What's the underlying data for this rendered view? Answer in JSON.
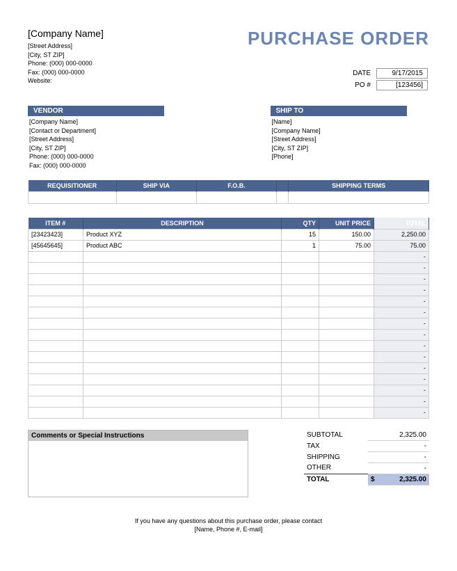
{
  "header": {
    "company_name": "[Company Name]",
    "street": "[Street Address]",
    "citystzip": "[City, ST  ZIP]",
    "phone_lbl": "Phone:",
    "phone": "(000) 000-0000",
    "fax_lbl": "Fax:",
    "fax": "(000) 000-0000",
    "website_lbl": "Website:"
  },
  "title": "PURCHASE ORDER",
  "meta": {
    "date_lbl": "DATE",
    "date": "9/17/2015",
    "po_lbl": "PO #",
    "po": "[123456]"
  },
  "vendor": {
    "hdr": "VENDOR",
    "lines": [
      "[Company Name]",
      "[Contact or Department]",
      "[Street Address]",
      "[City, ST  ZIP]",
      "Phone: (000) 000-0000",
      "Fax: (000) 000-0000"
    ]
  },
  "shipto": {
    "hdr": "SHIP TO",
    "lines": [
      "[Name]",
      "[Company Name]",
      "[Street Address]",
      "[City, ST  ZIP]",
      "[Phone]"
    ]
  },
  "ship_hdrs": {
    "req": "REQUISITIONER",
    "via": "SHIP VIA",
    "fob": "F.O.B.",
    "terms": "SHIPPING TERMS"
  },
  "item_hdrs": {
    "item": "ITEM #",
    "desc": "DESCRIPTION",
    "qty": "QTY",
    "price": "UNIT PRICE",
    "total": "TOTAL"
  },
  "items": [
    {
      "item": "[23423423]",
      "desc": "Product XYZ",
      "qty": "15",
      "price": "150.00",
      "total": "2,250.00"
    },
    {
      "item": "[45645645]",
      "desc": "Product ABC",
      "qty": "1",
      "price": "75.00",
      "total": "75.00"
    }
  ],
  "empty_total": "-",
  "comments_hdr": "Comments or Special Instructions",
  "totals": {
    "subtotal_lbl": "SUBTOTAL",
    "subtotal": "2,325.00",
    "tax_lbl": "TAX",
    "tax": "-",
    "shipping_lbl": "SHIPPING",
    "shipping": "-",
    "other_lbl": "OTHER",
    "other": "-",
    "total_lbl": "TOTAL",
    "total_cur": "$",
    "total": "2,325.00"
  },
  "footer": {
    "l1": "If you have any questions about this purchase order, please contact",
    "l2": "[Name, Phone #, E-mail]"
  }
}
